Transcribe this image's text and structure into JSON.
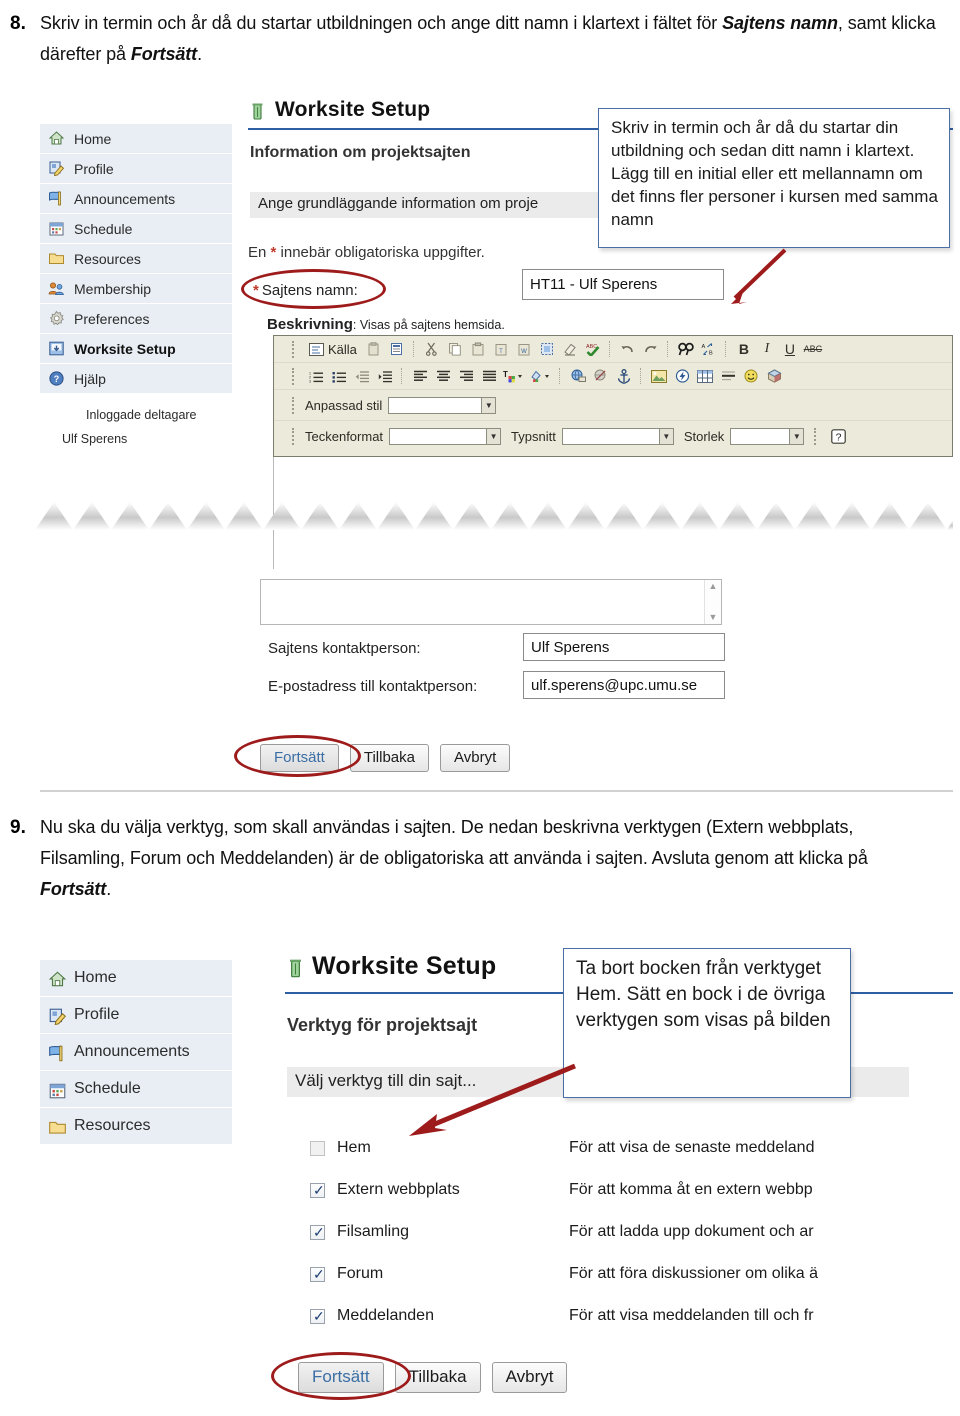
{
  "document": {
    "language": "sv",
    "accent_red": "#9e1b1b",
    "callout_border": "#4a6fa5",
    "nav_background": "#e9eef5",
    "header_rule": "#2e5fa3"
  },
  "steps": [
    {
      "number": "8.",
      "text_part_1": "Skriv in termin och år då du startar utbildningen och ange ditt namn i klartext i fältet för ",
      "emphasis_1": "Sajtens namn",
      "text_part_2": ", samt klicka därefter på ",
      "emphasis_2": "Fortsätt",
      "text_part_3": "."
    },
    {
      "number": "9.",
      "text_part_1": "Nu ska du välja verktyg, som skall användas i sajten. De nedan beskrivna verktygen (Extern webbplats, Filsamling, Forum och Meddelanden) är de obligatoriska att använda i sajten. Avsluta genom att klicka på ",
      "emphasis_1": "Fortsätt",
      "text_part_2": "."
    }
  ],
  "screenshot_1": {
    "nav": {
      "items": [
        {
          "label": "Home",
          "icon": "home-icon",
          "current": false
        },
        {
          "label": "Profile",
          "icon": "profile-icon",
          "current": false
        },
        {
          "label": "Announcements",
          "icon": "announcements-icon",
          "current": false
        },
        {
          "label": "Schedule",
          "icon": "calendar-icon",
          "current": false
        },
        {
          "label": "Resources",
          "icon": "folder-icon",
          "current": false
        },
        {
          "label": "Membership",
          "icon": "members-icon",
          "current": false
        },
        {
          "label": "Preferences",
          "icon": "gear-icon",
          "current": false
        },
        {
          "label": "Worksite Setup",
          "icon": "worksite-setup-icon",
          "current": true
        },
        {
          "label": "Hjälp",
          "icon": "help-icon",
          "current": false
        }
      ],
      "presence_heading": "Inloggade deltagare",
      "presence_user": "Ulf Sperens"
    },
    "page_title": "Worksite Setup",
    "section_heading": "Information om projektsajten",
    "instruction_bar": "Ange grundläggande information om proje",
    "required_note_prefix": "En ",
    "required_note_suffix": " innebär obligatoriska uppgifter.",
    "site_name_label": "Sajtens namn:",
    "site_name_value": "HT11 - Ulf Sperens",
    "description_label": "Beskrivning",
    "description_hint": ": Visas på sajtens hemsida.",
    "editor": {
      "source_label": "Källa",
      "custom_style_label": "Anpassad stil",
      "format_label": "Teckenformat",
      "font_label": "Typsnitt",
      "size_label": "Storlek",
      "bold_label": "B",
      "italic_label": "I",
      "underline_label": "U",
      "strike_label": "ABC",
      "help_label": "?"
    },
    "contact_label": "Sajtens kontaktperson:",
    "contact_value": "Ulf Sperens",
    "email_label": "E-postadress till kontaktperson:",
    "email_value": "ulf.sperens@upc.umu.se",
    "callout": "Skriv in termin och år då du startar din utbildning och sedan ditt namn i klartext. Lägg till en initial eller ett mellannamn om det finns fler personer i kursen med samma namn",
    "buttons": [
      {
        "label": "Fortsätt",
        "primary": true,
        "highlighted": true
      },
      {
        "label": "Tillbaka",
        "primary": false,
        "highlighted": false
      },
      {
        "label": "Avbryt",
        "primary": false,
        "highlighted": false
      }
    ]
  },
  "screenshot_2": {
    "nav": {
      "items": [
        {
          "label": "Home",
          "icon": "home-icon"
        },
        {
          "label": "Profile",
          "icon": "profile-icon"
        },
        {
          "label": "Announcements",
          "icon": "announcements-icon"
        },
        {
          "label": "Schedule",
          "icon": "calendar-icon"
        },
        {
          "label": "Resources",
          "icon": "folder-icon"
        }
      ]
    },
    "page_title": "Worksite Setup",
    "section_heading": "Verktyg för projektsajt",
    "instruction_bar": "Välj verktyg till din sajt...",
    "callout": "Ta bort bocken från verktyget Hem. Sätt en bock i de övriga verktygen som visas på bilden",
    "tools": [
      {
        "name": "Hem",
        "checked": false,
        "description": "För att visa de senaste meddeland"
      },
      {
        "name": "Extern webbplats",
        "checked": true,
        "description": "För att komma åt en extern webbp"
      },
      {
        "name": "Filsamling",
        "checked": true,
        "description": "För att ladda upp dokument och ar"
      },
      {
        "name": "Forum",
        "checked": true,
        "description": "För att föra diskussioner om olika ä"
      },
      {
        "name": "Meddelanden",
        "checked": true,
        "description": "För att visa meddelanden till och fr"
      }
    ],
    "buttons": [
      {
        "label": "Fortsätt",
        "primary": true,
        "highlighted": true
      },
      {
        "label": "Tillbaka",
        "primary": false,
        "highlighted": false
      },
      {
        "label": "Avbryt",
        "primary": false,
        "highlighted": false
      }
    ]
  }
}
